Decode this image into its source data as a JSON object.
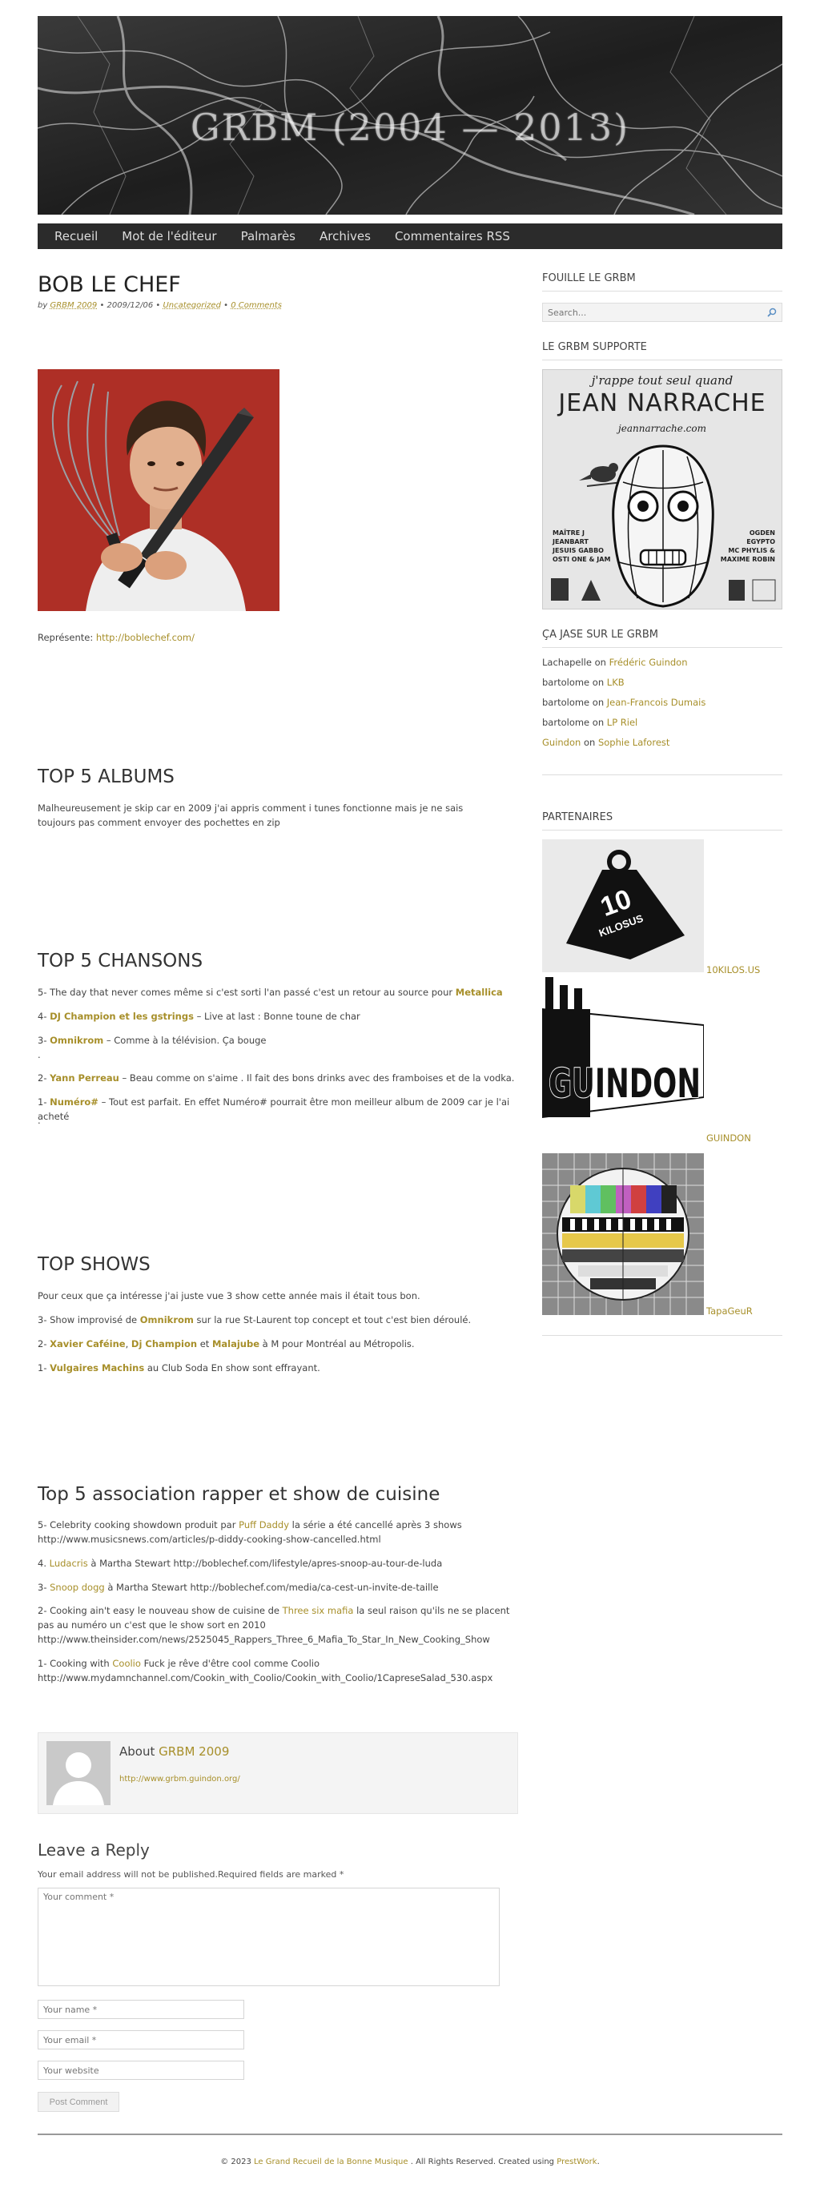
{
  "header": {
    "site_title": "GRBM (2004 — 2013)"
  },
  "nav": {
    "items": [
      "Recueil",
      "Mot de l'éditeur",
      "Palmarès",
      "Archives",
      "Commentaires RSS"
    ]
  },
  "post": {
    "title": "BOB LE CHEF",
    "meta": {
      "by": "by",
      "author": "GRBM 2009",
      "date": "2009/12/06",
      "category": "Uncategorized",
      "comments": "0 Comments"
    },
    "represente_label": "Représente:",
    "represente_link": "http://boblechef.com/"
  },
  "albums": {
    "title": "TOP 5 ALBUMS",
    "text": "Malheureusement je skip car en 2009 j'ai appris comment i tunes fonctionne mais je ne sais toujours pas comment envoyer des  pochettes en zip"
  },
  "chansons": {
    "title": "TOP 5 CHANSONS",
    "l5_pre": "5- The day that never comes même si c'est sorti l'an passé c'est un retour au source pour ",
    "l5_link": "Metallica",
    "l4_pre": "4- ",
    "l4_link": "DJ Champion et les gstrings",
    "l4_post": " – Live at last : Bonne toune de char",
    "l3_pre": "3- ",
    "l3_link": "Omnikrom",
    "l3_post": " – Comme à la télévision. Ça bouge",
    "dot1": ".",
    "l2_pre": "2- ",
    "l2_link": "Yann Perreau",
    "l2_post": " – Beau comme on s'aime . Il fait des bons drinks avec des framboises et de la vodka.",
    "l1_pre": "1- ",
    "l1_link": "Numéro#",
    "l1_post": " – Tout est parfait.  En effet Numéro# pourrait être mon meilleur album de 2009 car je l'ai acheté",
    "dot2": "."
  },
  "shows": {
    "title": "TOP SHOWS",
    "intro": "Pour ceux que ça intéresse j'ai juste vue 3 show cette année mais il était tous bon.",
    "s3_pre": "3- Show improvisé de ",
    "s3_link": "Omnikrom",
    "s3_post": " sur la rue St-Laurent top concept et tout c'est bien déroulé.",
    "s2_pre": "2- ",
    "s2_link1": "Xavier Caféine",
    "s2_sep": ", ",
    "s2_link2": "Dj Champion",
    "s2_mid": " et ",
    "s2_link3": "Malajube",
    "s2_post": " à M pour Montréal au Métropolis.",
    "s1_pre": "1- ",
    "s1_link": "Vulgaires Machins",
    "s1_post": " au Club Soda  En show sont effrayant."
  },
  "rapper": {
    "title": "Top 5 association rapper et show de cuisine",
    "r5_pre": "5- Celebrity cooking showdown produit par ",
    "r5_link": "Puff Daddy",
    "r5_post": " la série a été cancellé après 3 shows",
    "r5_url": "http://www.musicsnews.com/articles/p-diddy-cooking-show-cancelled.html",
    "r4_pre": "4. ",
    "r4_link": "Ludacris",
    "r4_post": " à Martha Stewart http://boblechef.com/lifestyle/apres-snoop-au-tour-de-luda",
    "r3_pre": "3- ",
    "r3_link": "Snoop dogg",
    "r3_post": " à Martha Stewart http://boblechef.com/media/ca-cest-un-invite-de-taille",
    "r2_pre": "2- Cooking ain't easy le nouveau show de cuisine de ",
    "r2_link": "Three six mafia",
    "r2_post": " la seul raison qu'ils ne se placent pas au numéro un c'est que le show sort en 2010",
    "r2_url": "http://www.theinsider.com/news/2525045_Rappers_Three_6_Mafia_To_Star_In_New_Cooking_Show",
    "r1_pre": "1- Cooking with ",
    "r1_link": "Coolio",
    "r1_post": " Fuck je rêve d'être cool comme Coolio",
    "r1_url": "http://www.mydamnchannel.com/Cookin_with_Coolio/Cookin_with_Coolio/1CapreseSalad_530.aspx"
  },
  "author_box": {
    "about": "About",
    "name": "GRBM 2009",
    "url": "http://www.grbm.guindon.org/"
  },
  "reply": {
    "title": "Leave a Reply",
    "note": "Your email address will not be published.Required fields are marked *",
    "comment_placeholder": "Your comment *",
    "name_placeholder": "Your name *",
    "email_placeholder": "Your email *",
    "website_placeholder": "Your website",
    "submit": "Post Comment"
  },
  "footer": {
    "pre": "© 2023 ",
    "link1": "Le Grand Recueil de la Bonne Musique",
    "mid": " . All Rights Reserved. Created using ",
    "link2": "PrestWork",
    "post": "."
  },
  "sidebar": {
    "search_title": "FOUILLE LE GRBM",
    "search_placeholder": "Search...",
    "supporte_title": "LE GRBM SUPPORTE",
    "poster": {
      "tagline": "j'rappe tout seul quand",
      "name": "JEAN NARRACHE",
      "site": "jeannarrache.com",
      "left_credits": [
        "MAÎTRE J",
        "JEANBART",
        "JESUIS GABBO",
        "OSTI ONE & JAM"
      ],
      "right_credits": [
        "OGDEN",
        "EGYPTO",
        "MC PHYLIS &",
        "MAXIME ROBIN"
      ]
    },
    "jase_title": "ÇA JASE SUR LE GRBM",
    "recent_comments": [
      {
        "who": "Lachapelle",
        "on": " on ",
        "post": "Frédéric Guindon"
      },
      {
        "who": "bartolome",
        "on": " on ",
        "post": "LKB"
      },
      {
        "who": "bartolome",
        "on": " on ",
        "post": "Jean-Francois Dumais"
      },
      {
        "who": "bartolome",
        "on": " on ",
        "post": "LP Riel"
      },
      {
        "who": "Guindon",
        "on": " on ",
        "post": "Sophie Laforest"
      }
    ],
    "partners_title": "PARTENAIRES",
    "partners": [
      {
        "label": "10KILOS.US",
        "logo_text1": "10",
        "logo_text2": "KILOSUS"
      },
      {
        "label": "GUINDON",
        "logo_text": "GUINDON"
      },
      {
        "label": "TapaGeuR"
      }
    ]
  },
  "colors": {
    "accent": "#a78f2a",
    "nav_bg": "#2b2b2b",
    "text": "#444444"
  }
}
